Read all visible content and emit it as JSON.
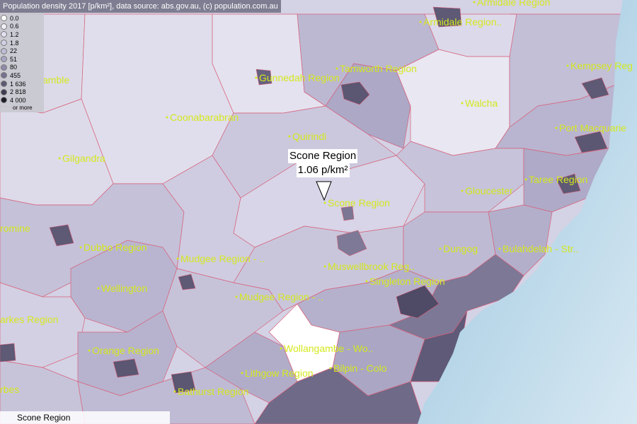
{
  "attribution": "Population density 2017 [p/km²], data source: abs.gov.au, (c) population.com.au",
  "legend": {
    "items": [
      {
        "label": "0.0",
        "color": "#ffffff"
      },
      {
        "label": "0.6",
        "color": "#f0eff6"
      },
      {
        "label": "1.2",
        "color": "#e2e0ee"
      },
      {
        "label": "1.8",
        "color": "#d2d0e4"
      },
      {
        "label": "22",
        "color": "#bfbcd6"
      },
      {
        "label": "51",
        "color": "#a9a5c4"
      },
      {
        "label": "80",
        "color": "#908ba9"
      },
      {
        "label": "455",
        "color": "#77728f"
      },
      {
        "label": "1 636",
        "color": "#5d5873"
      },
      {
        "label": "2 818",
        "color": "#3f3b50"
      },
      {
        "label": "4 000",
        "color": "#1e1c28"
      }
    ],
    "more_label": "or more"
  },
  "tooltip": {
    "region": "Scone Region",
    "value": "1.06 p/km²"
  },
  "selected_region": "Scone Region",
  "labels": {
    "armidale_1": "Armidale Region",
    "armidale_2": "Armidale Region..",
    "gunnedah": "Gunnedah Region",
    "tamworth": "Tamworth Region",
    "kempsey": "Kempsey Reg",
    "amble": "amble",
    "walcha": "Walcha",
    "coonabarabran": "Coonabarabran",
    "port_macquarie": "Port Macquarie",
    "quirindi": "Quirindi",
    "gilgandra": "Gilgandra",
    "taree": "Taree Region",
    "gloucester": "Gloucester",
    "scone": "Scone Region",
    "romine": "romine",
    "dubbo": "Dubbo Region",
    "dungog": "Dungog",
    "bulahdelah": "Bulahdelah - Str..",
    "mudgee_1": "Mudgee Region - ..",
    "muswellbrook": "Muswellbrook Reg..",
    "singleton": "Singleton Region",
    "wellington": "Wellington",
    "mudgee_2": "Mudgee Region - ..",
    "parkes": "arkes Region",
    "wollangambe": "Wollangambe - Wo..",
    "orange": "Orange Region",
    "bilpin": "Bilpin - Colo",
    "lithgow": "Lithgow Region",
    "forbes": "rbes",
    "bathurst": "Bathurst Region"
  },
  "colors": {
    "sea": "#a9cde3",
    "boundary": "#d9607a",
    "label": "#d4e81e"
  }
}
